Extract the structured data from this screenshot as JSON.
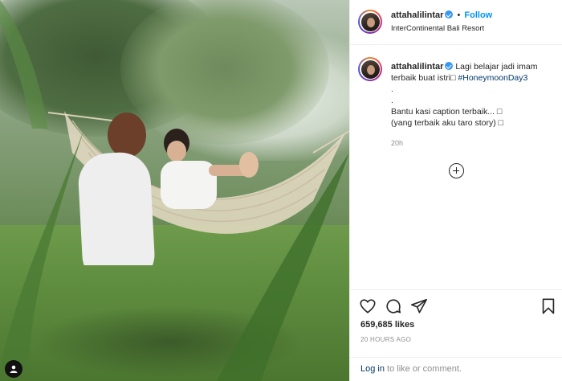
{
  "post": {
    "username": "attahalilintar",
    "location": "InterContinental Bali Resort",
    "follow_label": "Follow",
    "header_separator": "•",
    "caption_lines": [
      "Lagi belajar jadi imam",
      "terbaik buat istri",
      "#HoneymoonDay3",
      ".",
      ".",
      "Bantu kasi caption terbaik... ",
      "(yang terbaik aku taro story) "
    ],
    "caption_emoji_placeholder": "□",
    "time_ago": "20h",
    "likes": "659,685 likes",
    "timestamp": "20 HOURS AGO",
    "login_link": "Log in",
    "login_suffix": " to like or comment.",
    "colors": {
      "accent": "#0095f6",
      "verified": "#3897f0",
      "hashtag": "#00376b",
      "muted": "#8e8e8e",
      "text": "#262626"
    },
    "icons": [
      "verified-badge-icon",
      "add-comment-icon",
      "heart-icon",
      "comment-icon",
      "share-icon",
      "bookmark-icon",
      "user-tag-icon"
    ]
  }
}
